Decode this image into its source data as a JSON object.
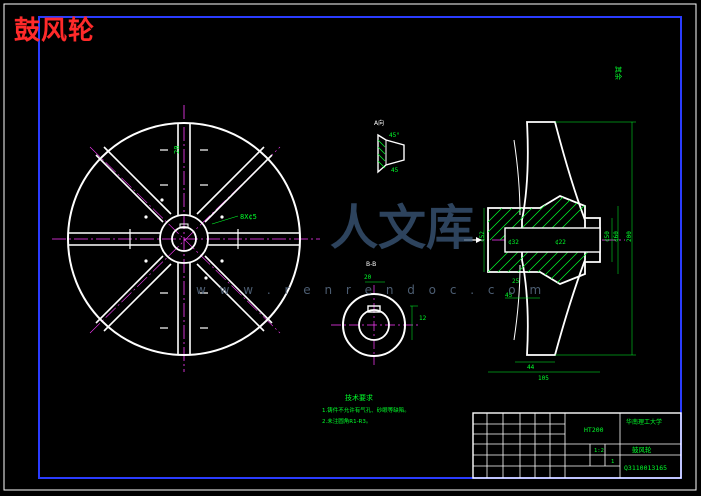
{
  "page_title": "鼓风轮",
  "watermark": {
    "logo_text": "人文库",
    "url_text": "w w w . r e n r e n d o c . c o m"
  },
  "roughness_note": "其余",
  "technical_requirements": {
    "heading": "技术要求",
    "items": [
      "1.铸件不允许有气孔、砂眼等缺陷。",
      "2.未注圆角R1-R3。"
    ]
  },
  "dimensions": {
    "front": {
      "hole": "8X¢5",
      "slot": "20"
    },
    "detail": {
      "label": "A向",
      "angle": "45°"
    },
    "section_view": {
      "label": "B-B",
      "width": "20",
      "height": "12",
      "side": "12"
    },
    "side_view": {
      "overall_height": "200",
      "d1": "¢52",
      "d2": "¢32",
      "d3": "¢22",
      "d4": "¢50",
      "d5": "¢60",
      "w1": "44",
      "w2": "105",
      "w3": "45",
      "w4": "25"
    }
  },
  "title_block": {
    "material": "HT200",
    "school": "华南理工大学",
    "part_name": "鼓风轮",
    "drawing_no": "Q3110013165",
    "scale": "1:2",
    "sheet": "1"
  }
}
